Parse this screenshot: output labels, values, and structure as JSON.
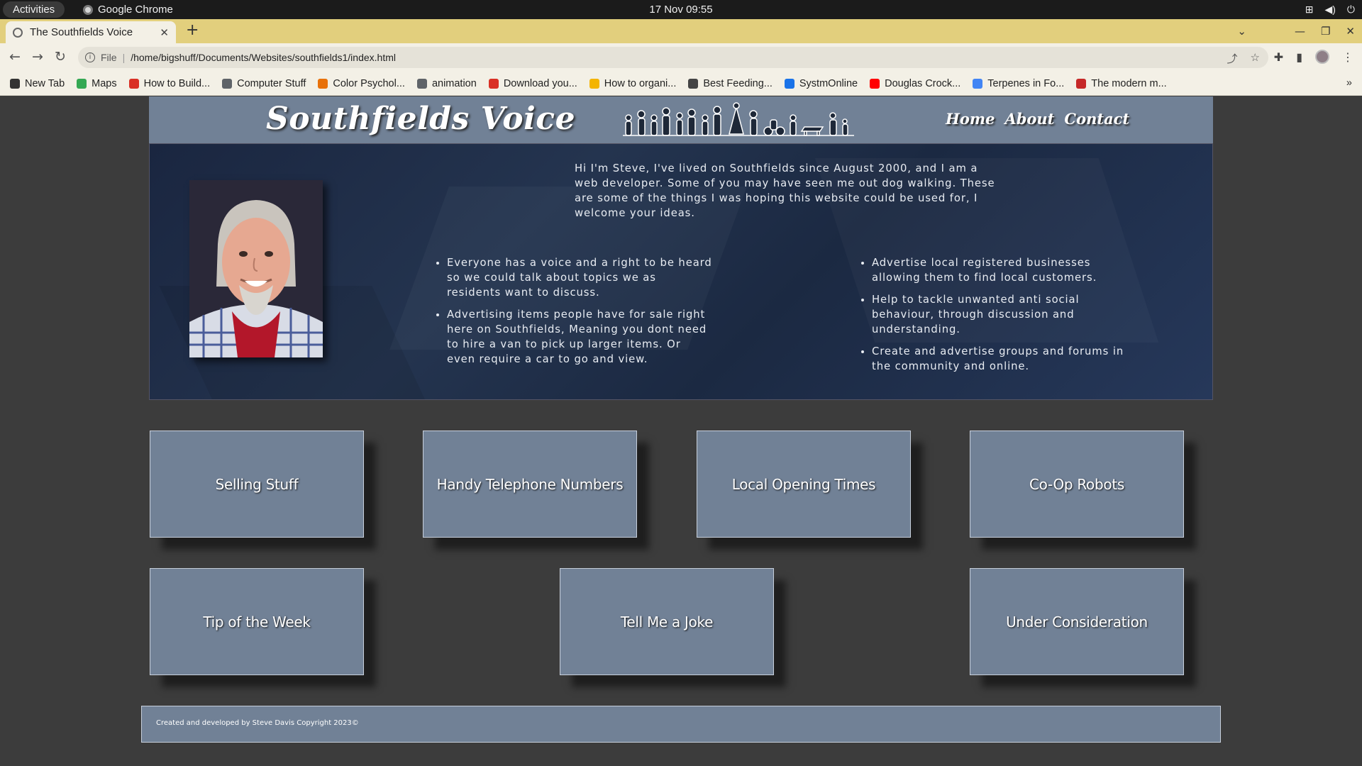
{
  "gnome": {
    "activities": "Activities",
    "app_name": "Google Chrome",
    "clock": "17 Nov  09:55"
  },
  "browser": {
    "tab_title": "The Southfields Voice",
    "url_scheme": "File",
    "url": "/home/bigshuff/Documents/Websites/southfields1/index.html",
    "bookmarks": [
      {
        "label": "New Tab",
        "color": "#333333"
      },
      {
        "label": "Maps",
        "color": "#34a853"
      },
      {
        "label": "How to Build...",
        "color": "#d93025"
      },
      {
        "label": "Computer Stuff",
        "color": "#5f6368"
      },
      {
        "label": "Color Psychol...",
        "color": "#e8710a"
      },
      {
        "label": "animation",
        "color": "#5f6368"
      },
      {
        "label": "Download you...",
        "color": "#d93025"
      },
      {
        "label": "How to organi...",
        "color": "#f4b400"
      },
      {
        "label": "Best Feeding...",
        "color": "#444444"
      },
      {
        "label": "SystmOnline",
        "color": "#1a73e8"
      },
      {
        "label": "Douglas Crock...",
        "color": "#ff0000"
      },
      {
        "label": "Terpenes in Fo...",
        "color": "#4285f4"
      },
      {
        "label": "The modern m...",
        "color": "#c62828"
      }
    ],
    "bookmarks_more": "»"
  },
  "site": {
    "brand": "Southfields Voice",
    "nav": [
      "Home",
      "About",
      "Contact"
    ],
    "intro": "Hi I'm Steve, I've lived on Southfields since August 2000, and I am a web developer. Some of you may have seen me out dog walking. These are some of the things I was hoping this website could be used for, I welcome your ideas.",
    "bullets_left": [
      "Everyone has a voice and a right to be heard so we could talk about topics we as residents want to discuss.",
      "Advertising items people have for sale right here on Southfields, Meaning you dont need to hire a van to pick up larger items. Or even require a car to go and view."
    ],
    "bullets_right": [
      "Advertise local registered businesses allowing them to find local customers.",
      "Help to tackle unwanted anti social behaviour, through discussion and understanding.",
      "Create and advertise groups and forums in the community and online."
    ],
    "cards": [
      "Selling Stuff",
      "Handy Telephone Numbers",
      "Local Opening Times",
      "Co-Op Robots",
      "Tip of the Week",
      "Tell Me a Joke",
      "Under Consideration"
    ],
    "footer": "Created and developed by Steve Davis Copyright 2023©"
  },
  "colors": {
    "page_bg": "#3c3c3c",
    "header_bg": "#718196",
    "hero_bg": "#1f2d47",
    "tab_strip": "#e2cf7d"
  }
}
